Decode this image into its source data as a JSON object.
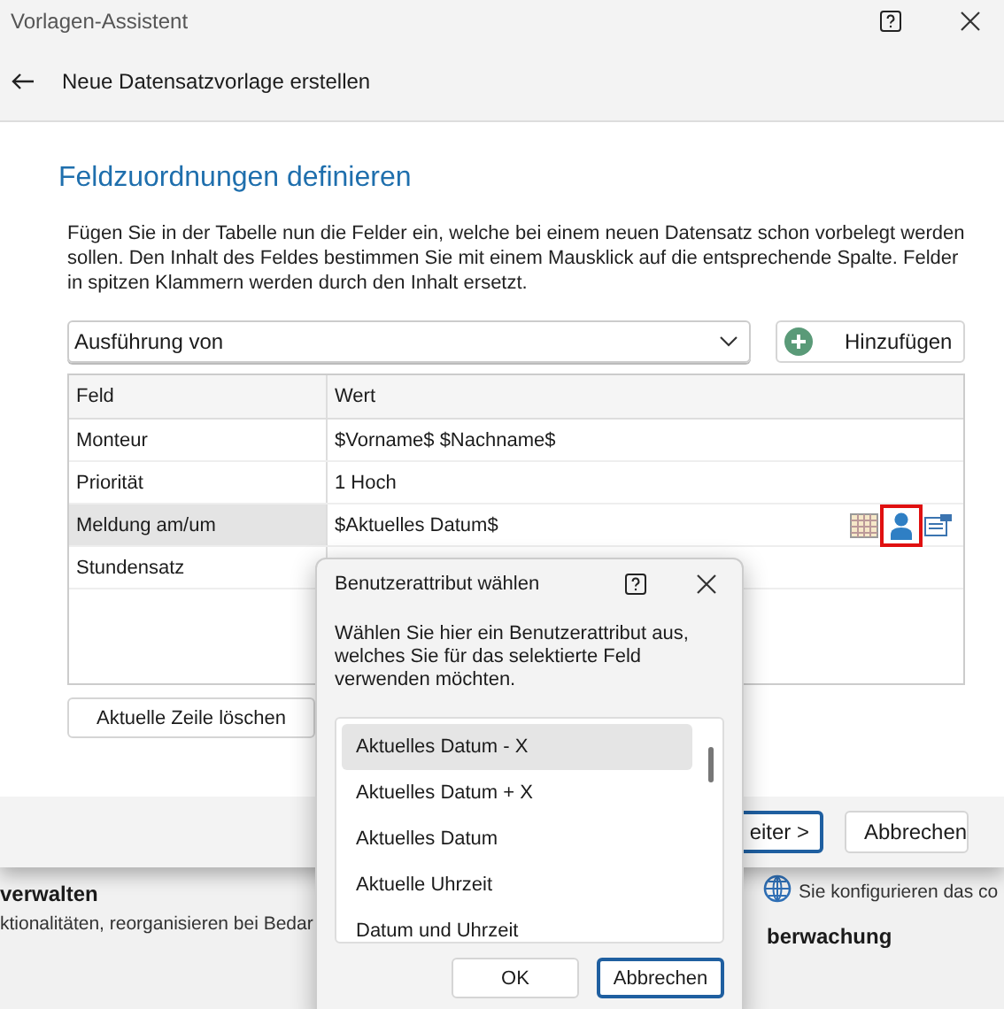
{
  "window": {
    "title": "Vorlagen-Assistent"
  },
  "header": {
    "title": "Neue Datensatzvorlage erstellen"
  },
  "page": {
    "heading": "Feldzuordnungen definieren",
    "description": "Fügen Sie in der Tabelle nun die Felder ein, welche bei einem neuen Datensatz schon vorbelegt werden sollen. Den Inhalt des Feldes bestimmen Sie mit einem Mausklick auf die entsprechende Spalte. Felder in spitzen Klammern werden durch den Inhalt ersetzt."
  },
  "field_select": {
    "value": "Ausführung von"
  },
  "add_button": {
    "label": "Hinzufügen"
  },
  "table": {
    "columns": [
      "Feld",
      "Wert"
    ],
    "rows": [
      {
        "field": "Monteur",
        "value": "$Vorname$ $Nachname$",
        "selected": false
      },
      {
        "field": "Priorität",
        "value": "1 Hoch",
        "selected": false
      },
      {
        "field": "Meldung am/um",
        "value": "$Aktuelles Datum$",
        "selected": true
      },
      {
        "field": "Stundensatz",
        "value": "",
        "selected": false
      }
    ]
  },
  "delete_button": {
    "label": "Aktuelle Zeile löschen"
  },
  "footer_buttons": [
    {
      "label": "eiter >",
      "default": true
    },
    {
      "label": "Abbrechen",
      "default": false
    }
  ],
  "background": {
    "left_title": "verwalten",
    "left_text": "ktionalitäten, reorganisieren bei Bedar",
    "right_text": "Sie konfigurieren das co",
    "right_title": "berwachung"
  },
  "dialog": {
    "title": "Benutzerattribut wählen",
    "text": "Wählen Sie hier ein Benutzerattribut aus, welches Sie für das selektierte Feld verwenden möchten.",
    "items": [
      {
        "label": "Aktuelles Datum - X",
        "selected": true
      },
      {
        "label": "Aktuelles Datum + X",
        "selected": false
      },
      {
        "label": "Aktuelles Datum",
        "selected": false
      },
      {
        "label": "Aktuelle Uhrzeit",
        "selected": false
      },
      {
        "label": "Datum und Uhrzeit",
        "selected": false
      }
    ],
    "buttons": [
      {
        "label": "OK",
        "default": false
      },
      {
        "label": "Abbrechen",
        "default": true
      }
    ]
  }
}
